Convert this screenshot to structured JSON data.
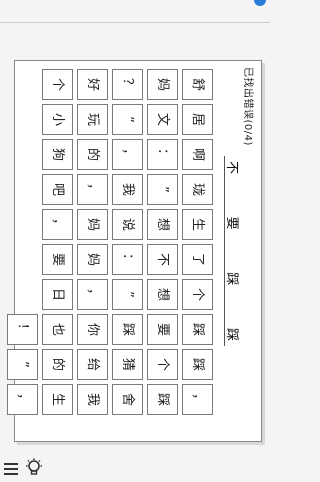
{
  "status": {
    "text": "已找出错误(0/4)"
  },
  "target": {
    "chars": [
      "不",
      "要",
      "踩",
      "踩"
    ]
  },
  "grid": {
    "rows": [
      [
        "舒",
        "居",
        "啊",
        "珑",
        "生",
        "了",
        "个",
        "踩",
        "踩",
        "，"
      ],
      [
        "妈",
        "文",
        "：",
        "”",
        "想",
        "不",
        "想",
        "要",
        "个",
        "踩"
      ],
      [
        "？",
        "”",
        "，",
        "我",
        "说",
        "：",
        "”",
        "踩",
        "猜",
        "舍"
      ],
      [
        "好",
        "玩",
        "的",
        "，",
        "妈",
        "妈",
        "，",
        "你",
        "给",
        "我"
      ],
      [
        "个",
        "小",
        "狗",
        "吧",
        "，",
        "要",
        "日",
        "也",
        "的",
        "生"
      ],
      [
        "",
        "",
        "",
        "",
        "",
        "",
        "",
        "！",
        "”",
        "，"
      ]
    ]
  },
  "icons": {
    "menu": "menu-icon",
    "hint": "lightbulb-icon"
  }
}
